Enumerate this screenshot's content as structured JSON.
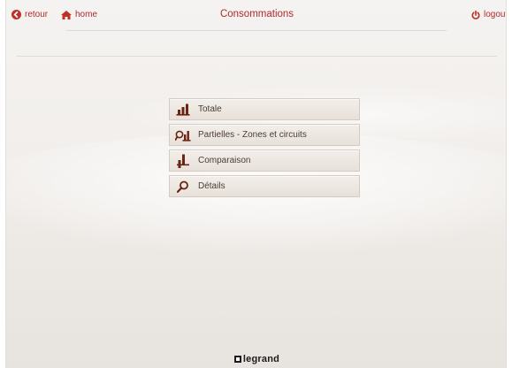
{
  "header": {
    "back_label": "retour",
    "home_label": "home",
    "title": "Consommations",
    "logout_label": "logout"
  },
  "menu": {
    "items": [
      {
        "label": "Totale",
        "icon": "bar-chart-icon"
      },
      {
        "label": "Partielles - Zones et circuits",
        "icon": "search-chart-icon"
      },
      {
        "label": "Comparaison",
        "icon": "comparison-chart-icon"
      },
      {
        "label": "Détails",
        "icon": "magnifier-icon"
      }
    ]
  },
  "footer": {
    "logo_text": "legrand"
  },
  "colors": {
    "accent": "#b02a2a",
    "icon_dark": "#5a2a1a",
    "text": "#4a3d36"
  }
}
